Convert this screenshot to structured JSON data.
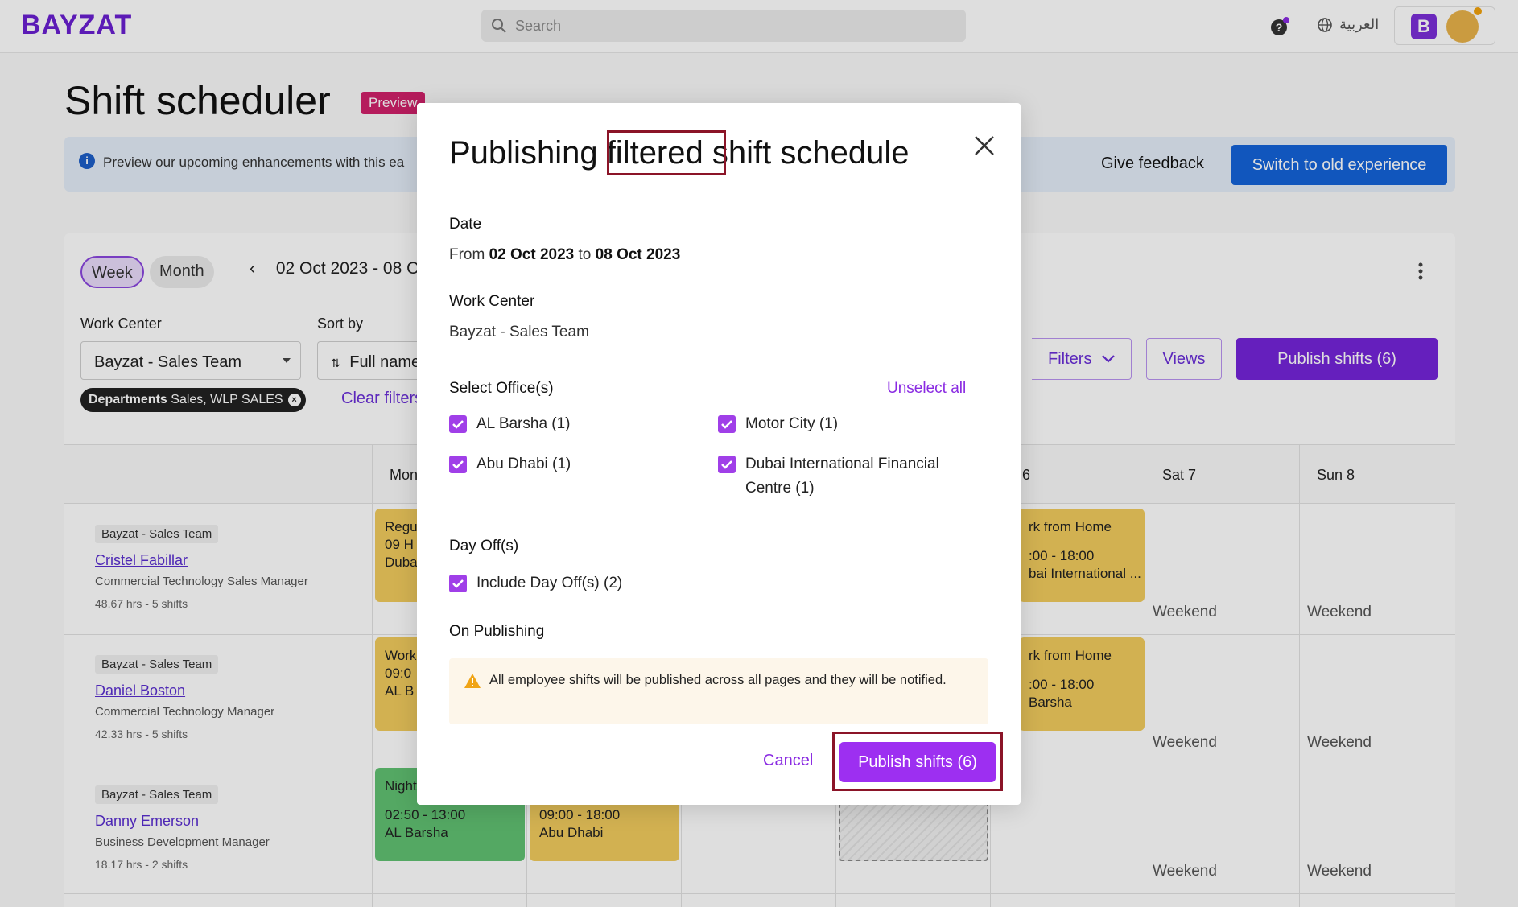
{
  "topbar": {
    "logo": "BAYZAT",
    "search_placeholder": "Search",
    "language": "العربية",
    "profile_letter": "B"
  },
  "page": {
    "title": "Shift scheduler",
    "badge": "Preview"
  },
  "banner": {
    "text": "Preview our upcoming enhancements with this ea",
    "feedback": "Give feedback",
    "old_experience": "Switch to old experience"
  },
  "toolbar": {
    "week": "Week",
    "month": "Month",
    "date_range": "02 Oct 2023 - 08 O",
    "work_center_label": "Work Center",
    "work_center_value": "Bayzat - Sales Team",
    "sort_label": "Sort by",
    "sort_value": "Full name",
    "chip_label": "Departments",
    "chip_value": "Sales, WLP SALES",
    "clear_filters": "Clear filters",
    "filters": "Filters",
    "views": "Views",
    "publish": "Publish shifts (6)"
  },
  "grid": {
    "columns": [
      "Mon",
      "6",
      "Sat 7",
      "Sun 8"
    ],
    "employees": [
      {
        "team": "Bayzat - Sales Team",
        "name": "Cristel Fabillar",
        "role": "Commercial Technology Sales Manager",
        "hours": "48.67 hrs - 5 shifts"
      },
      {
        "team": "Bayzat - Sales Team",
        "name": "Daniel Boston",
        "role": "Commercial Technology Manager",
        "hours": "42.33 hrs - 5 shifts"
      },
      {
        "team": "Bayzat - Sales Team",
        "name": "Danny Emerson",
        "role": "Business Development Manager",
        "hours": "18.17 hrs - 2 shifts"
      }
    ],
    "shifts": {
      "r1_mon": "Regu\n09 H\nDuba",
      "r1_fri_title": "rk from Home",
      "r1_fri_time": ":00 - 18:00",
      "r1_fri_loc": "bai International ...",
      "r2_mon": "Work\n09:0\nAL B",
      "r2_fri_title": "rk from Home",
      "r2_fri_time": ":00 - 18:00",
      "r2_fri_loc": "Barsha",
      "r3_mon_title": "Night",
      "r3_mon_time": "02:50 - 13:00",
      "r3_mon_loc": "AL Barsha",
      "r3_tue_time": "09:00 - 18:00",
      "r3_tue_loc": "Abu Dhabi"
    },
    "weekend": "Weekend"
  },
  "modal": {
    "title_before": "Publishing ",
    "title_highlight": "filtered",
    "title_after": " shift schedule",
    "date_label": "Date",
    "date_from": "From ",
    "date_start": "02 Oct 2023",
    "date_to": " to ",
    "date_end": "08 Oct 2023",
    "work_center_label": "Work Center",
    "work_center_value": "Bayzat - Sales Team",
    "offices_label": "Select Office(s)",
    "unselect_all": "Unselect all",
    "offices": [
      "AL Barsha (1)",
      "Motor City (1)",
      "Abu Dhabi (1)",
      "Dubai International Financial Centre (1)"
    ],
    "day_off_label": "Day Off(s)",
    "day_off_option": "Include Day Off(s) (2)",
    "on_publishing_label": "On Publishing",
    "warning": "All employee shifts will be published across all pages and they will be notified.",
    "cancel": "Cancel",
    "publish": "Publish shifts (6)"
  },
  "colors": {
    "brand": "#7424d9",
    "accent": "#9d2ff1",
    "highlight_box": "#8b1428",
    "old_exp_button": "#1463d9"
  }
}
